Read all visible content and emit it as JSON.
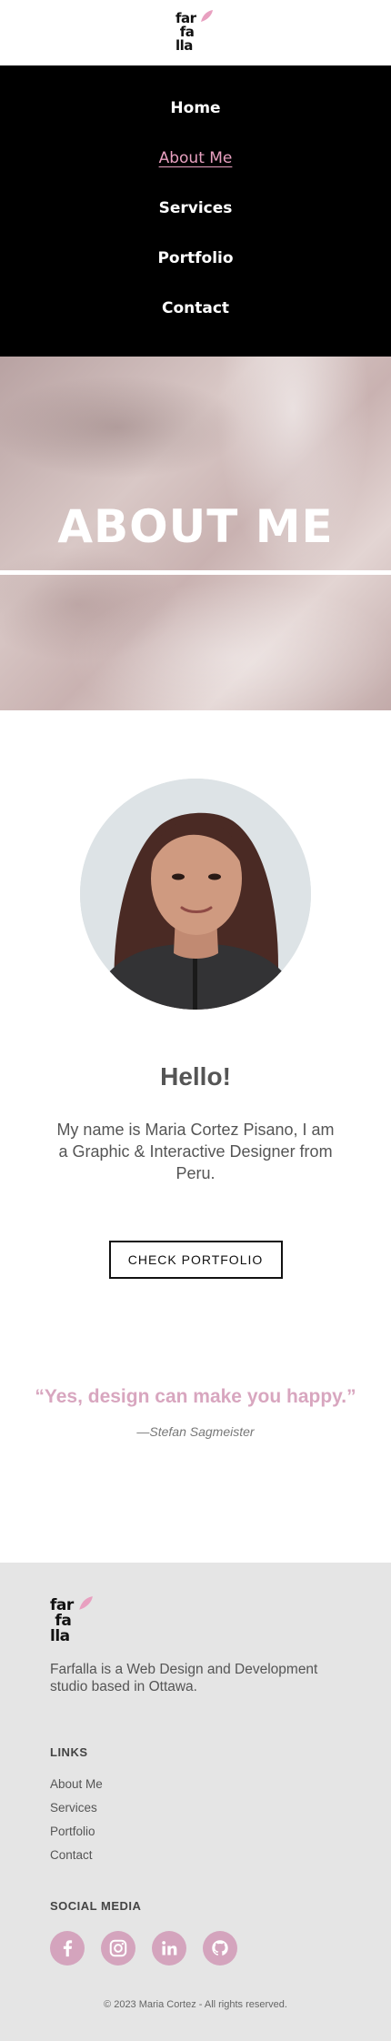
{
  "header": {
    "logo_text": "far\n fa\nlla"
  },
  "nav": {
    "items": [
      {
        "label": "Home",
        "active": false
      },
      {
        "label": "About Me",
        "active": true
      },
      {
        "label": "Services",
        "active": false
      },
      {
        "label": "Portfolio",
        "active": false
      },
      {
        "label": "Contact",
        "active": false
      }
    ]
  },
  "hero": {
    "title": "ABOUT ME"
  },
  "about": {
    "greeting": "Hello!",
    "intro": "My name is Maria Cortez Pisano, I am a Graphic & Interactive Designer from Peru.",
    "cta_label": "CHECK PORTFOLIO"
  },
  "quote": {
    "text": "“Yes, design can make you happy.”",
    "author": "—Stefan Sagmeister"
  },
  "footer": {
    "logo_text": "far\n fa\nlla",
    "description": "Farfalla is a Web Design and Development studio based in Ottawa.",
    "links_heading": "LINKS",
    "links": [
      "About Me",
      "Services",
      "Portfolio",
      "Contact"
    ],
    "social_heading": "SOCIAL MEDIA",
    "social_icons": [
      "facebook-icon",
      "instagram-icon",
      "linkedin-icon",
      "github-icon"
    ],
    "copyright": "© 2023 Maria Cortez - All rights reserved."
  },
  "colors": {
    "accent_pink": "#d4a4bd",
    "nav_bg": "#000000",
    "footer_bg": "#e5e5e5"
  }
}
